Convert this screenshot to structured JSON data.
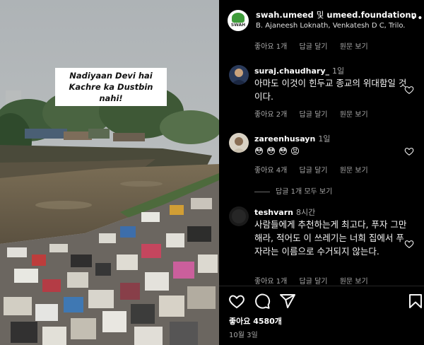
{
  "post": {
    "caption_line1": "Nadiyaan Devi hai",
    "caption_line2": "Kachre ka Dustbin nahi!"
  },
  "header": {
    "username": "swah.umeed",
    "separator": "및",
    "collaborator": "umeed.foundationn",
    "tagged": "B. Ajaneesh Loknath, Venkatesh D C, Trilo..."
  },
  "top_meta": {
    "likes": "좋아요 1개",
    "reply": "답글 달기",
    "original": "원문 보기"
  },
  "comments": [
    {
      "username": "suraj.chaudhary_",
      "time": "1일",
      "text": "아마도 이것이 힌두교 종교의 위대함일 것이다.",
      "likes": "좋아요 2개",
      "reply": "답글 달기",
      "original": "원문 보기"
    },
    {
      "username": "zareenhusayn",
      "time": "1일",
      "text": "😳 😳 😳 😡",
      "likes": "좋아요 4개",
      "reply": "답글 달기",
      "original": "원문 보기",
      "replies_toggle": "답글 1개 모두 보기"
    },
    {
      "username": "teshvarn",
      "time": "8시간",
      "text": "사람들에게 추천하는게 최고다, 푸자 그만해라, 적어도 이 쓰레기는 너희 집에서 푸자라는 이름으로 수거되지 않는다.",
      "likes": "좋아요 1개",
      "reply": "답글 달기",
      "original": "원문 보기"
    }
  ],
  "footer": {
    "like_count": "좋아요 4580개",
    "date": "10월 3일"
  },
  "icons": {
    "more": "more-options-icon",
    "heart": "heart-icon",
    "comment": "comment-icon",
    "share": "share-icon",
    "save": "bookmark-icon"
  },
  "colors": {
    "background": "#000000",
    "secondary_text": "#a8a8a8",
    "divider": "#262626"
  }
}
